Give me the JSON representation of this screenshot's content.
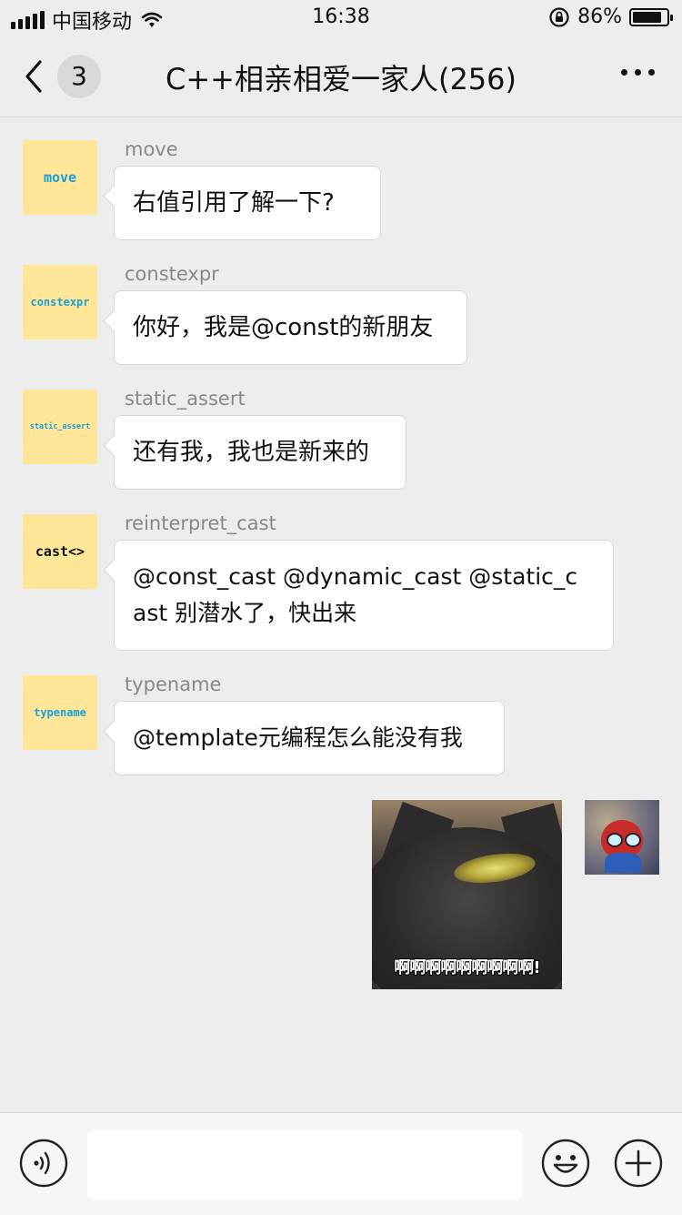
{
  "status_bar": {
    "carrier": "中国移动",
    "time": "16:38",
    "battery_percent": "86%",
    "battery_level": 0.86
  },
  "nav": {
    "unread_count": "3",
    "title": "C++相亲相爱一家人(256)"
  },
  "messages": [
    {
      "avatar_text": "move",
      "sender": "move",
      "lines": [
        "右值引用了解一下?"
      ]
    },
    {
      "avatar_text": "constexpr",
      "sender": "constexpr",
      "lines": [
        "你好，我是@const的新朋友"
      ]
    },
    {
      "avatar_text": "static_assert",
      "sender": "static_assert",
      "lines": [
        "还有我，我也是新来的"
      ]
    },
    {
      "avatar_text": "cast<>",
      "sender": "reinterpret_cast",
      "lines": [
        "@const_cast @dynamic_cast @static_c",
        "ast 别潜水了，快出来"
      ]
    },
    {
      "avatar_text": "typename",
      "sender": "typename",
      "lines": [
        "@template元编程怎么能没有我"
      ]
    }
  ],
  "sent_image": {
    "caption": "啊啊啊啊啊啊啊啊啊!"
  },
  "input_bar": {
    "text_value": ""
  },
  "icons": {
    "back": "chevron-left-icon",
    "more": "more-dots-icon",
    "voice": "voice-icon",
    "emoji": "emoji-icon",
    "plus": "plus-icon"
  }
}
